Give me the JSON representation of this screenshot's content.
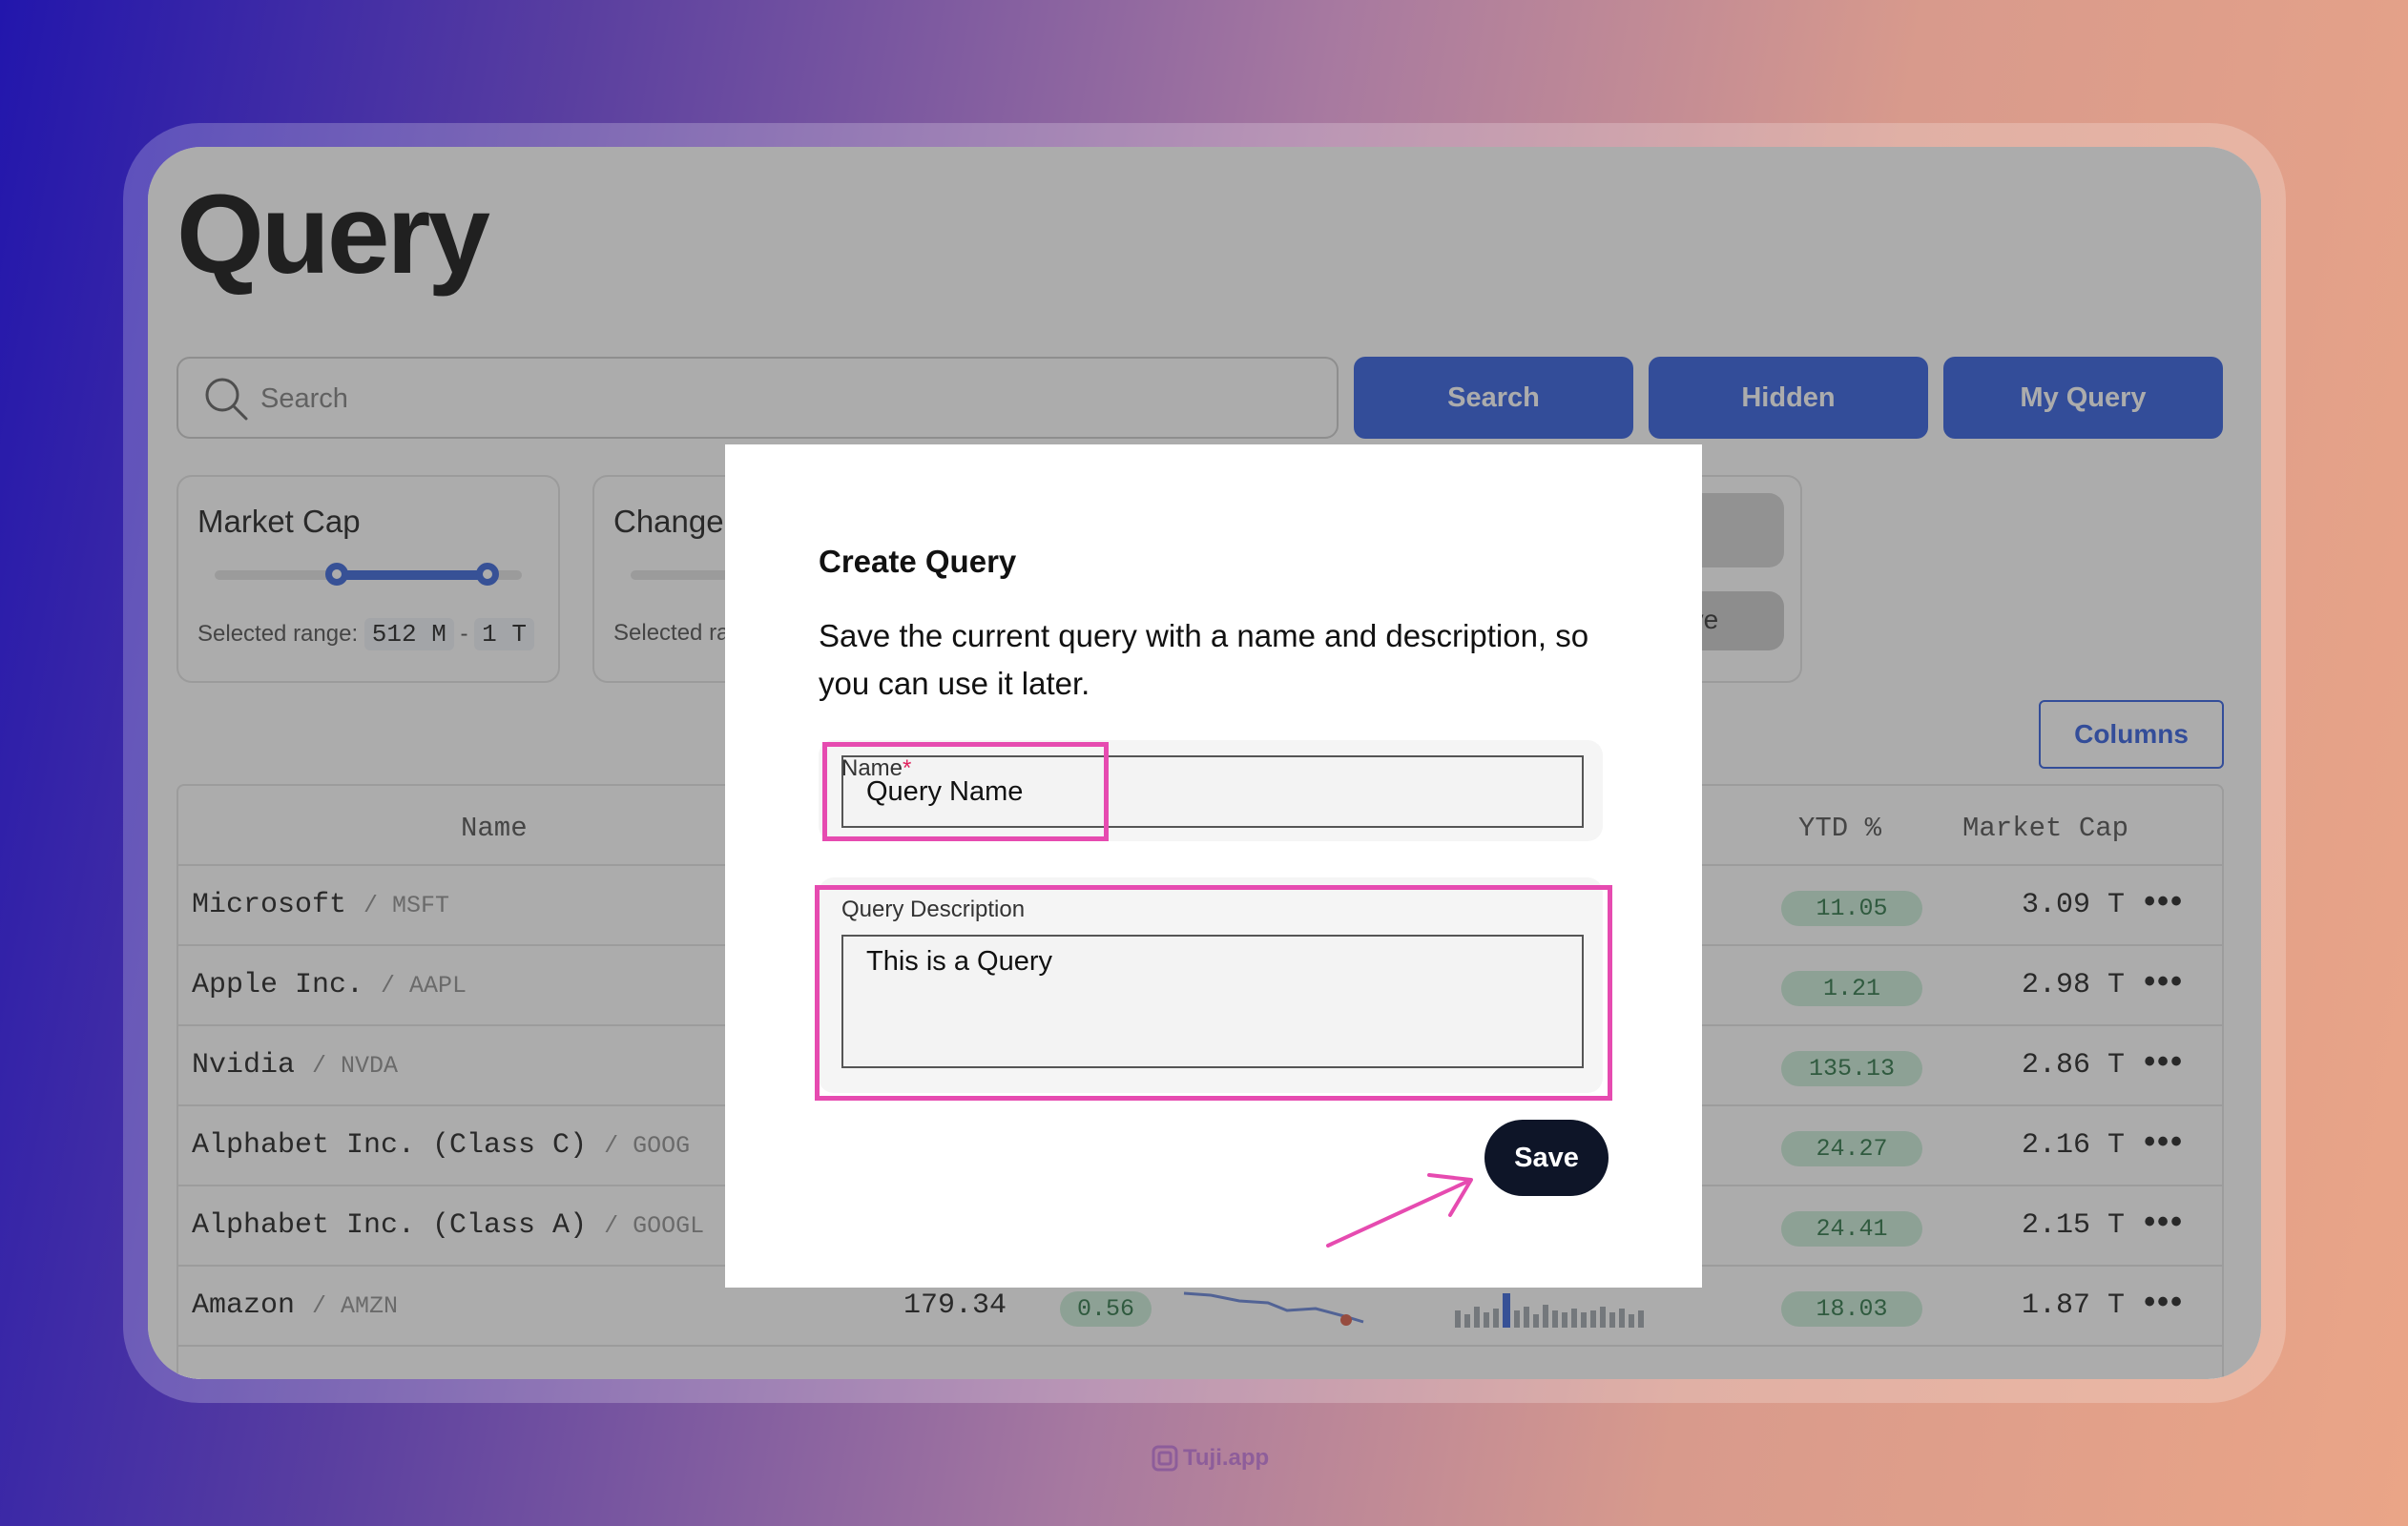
{
  "page": {
    "title": "Query"
  },
  "search": {
    "placeholder": "Search"
  },
  "toolbar": {
    "search_label": "Search",
    "hidden_label": "Hidden",
    "my_query_label": "My Query"
  },
  "filters": {
    "market_cap": {
      "title": "Market Cap",
      "range_prefix": "Selected range:",
      "min": "512 M",
      "max": "1 T",
      "separator": "-"
    },
    "change": {
      "title": "Change",
      "range_prefix": "Selected ra"
    },
    "partial_button": "ave"
  },
  "columns_button": "Columns",
  "table": {
    "headers": {
      "name": "Name",
      "ytd": "YTD %",
      "market_cap": "Market Cap"
    },
    "rows": [
      {
        "name": "Microsoft",
        "ticker": "/ MSFT",
        "ytd": "11.05",
        "market_cap": "3.09 T"
      },
      {
        "name": "Apple Inc.",
        "ticker": "/ AAPL",
        "ytd": "1.21",
        "market_cap": "2.98 T"
      },
      {
        "name": "Nvidia",
        "ticker": "/ NVDA",
        "ytd": "135.13",
        "market_cap": "2.86 T"
      },
      {
        "name": "Alphabet Inc. (Class C)",
        "ticker": "/ GOOG",
        "ytd": "24.27",
        "market_cap": "2.16 T"
      },
      {
        "name": "Alphabet Inc. (Class A)",
        "ticker": "/ GOOGL",
        "ytd": "24.41",
        "market_cap": "2.15 T"
      },
      {
        "name": "Amazon",
        "ticker": "/ AMZN",
        "price": "179.34",
        "change": "0.56",
        "ytd": "18.03",
        "market_cap": "1.87 T"
      }
    ],
    "more_icon": "ellipsis-icon"
  },
  "modal": {
    "title": "Create Query",
    "description": "Save the current query with a name and description, so you can use it later.",
    "name_label": "Name",
    "name_required": "*",
    "name_value": "Query Name",
    "desc_label": "Query Description",
    "desc_value": "This is a Query",
    "save_label": "Save"
  },
  "annotation": {
    "highlight_color": "#e64bb0"
  },
  "footer": {
    "brand": "Tuji.app"
  }
}
